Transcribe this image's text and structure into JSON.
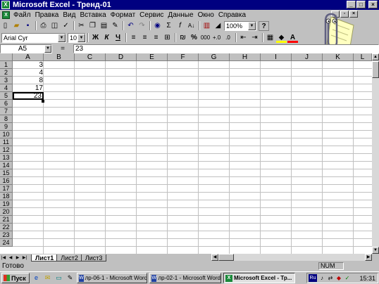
{
  "window": {
    "title": "Microsoft Excel - Тренд-01"
  },
  "menu": [
    "Файл",
    "Правка",
    "Вид",
    "Вставка",
    "Формат",
    "Сервис",
    "Данные",
    "Окно",
    "Справка"
  ],
  "toolbar": {
    "zoom": "100%",
    "help": "?",
    "sigma": "Σ",
    "fx": "f",
    "sort": "A↓"
  },
  "format": {
    "font": "Arial Cyr",
    "size": "10",
    "bold": "Ж",
    "italic": "К",
    "underline": "Ч",
    "percent": "%",
    "thousands": "000"
  },
  "formula": {
    "cell_ref": "A5",
    "equals": "=",
    "value": "23"
  },
  "columns": [
    "A",
    "B",
    "C",
    "D",
    "E",
    "F",
    "G",
    "H",
    "I",
    "J",
    "K",
    "L"
  ],
  "rows": [
    "1",
    "2",
    "3",
    "4",
    "5",
    "6",
    "7",
    "8",
    "9",
    "10",
    "11",
    "12",
    "13",
    "14",
    "15",
    "16",
    "17",
    "18",
    "19",
    "20",
    "21",
    "22",
    "23",
    "24"
  ],
  "cells": {
    "a1": "3",
    "a2": "4",
    "a3": "8",
    "a4": "17",
    "a5": "23"
  },
  "sheets": [
    "Лист1",
    "Лист2",
    "Лист3"
  ],
  "status": {
    "text": "Готово",
    "num": "NUM"
  },
  "taskbar": {
    "start": "Пуск",
    "tasks": [
      "лр-06-1 - Microsoft Word",
      "лр-02-1 - Microsoft Word",
      "Microsoft Excel - Тр..."
    ],
    "lang": "Ru",
    "clock": "15:31"
  }
}
